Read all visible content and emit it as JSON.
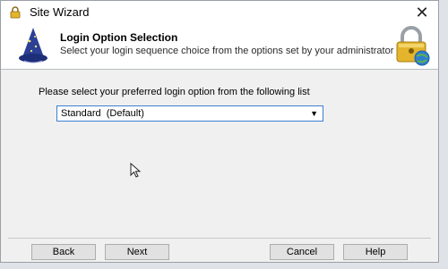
{
  "window": {
    "title": "Site Wizard",
    "close_glyph": "✕"
  },
  "header": {
    "title": "Login Option Selection",
    "subtitle": "Select your login sequence choice from the options set by your administrator"
  },
  "main": {
    "prompt": "Please select your preferred  login option from the following list",
    "login_option": {
      "selected": "Standard  (Default)"
    }
  },
  "footer": {
    "back_label": "Back",
    "next_label": "Next",
    "cancel_label": "Cancel",
    "help_label": "Help"
  },
  "icons": {
    "app": "lock-icon",
    "header_left": "wizard-hat-icon",
    "header_right": "lock-globe-icon",
    "cursor": "mouse-pointer-icon"
  },
  "colors": {
    "accent": "#3c7fd2",
    "lock_gold": "#e4b52c"
  }
}
